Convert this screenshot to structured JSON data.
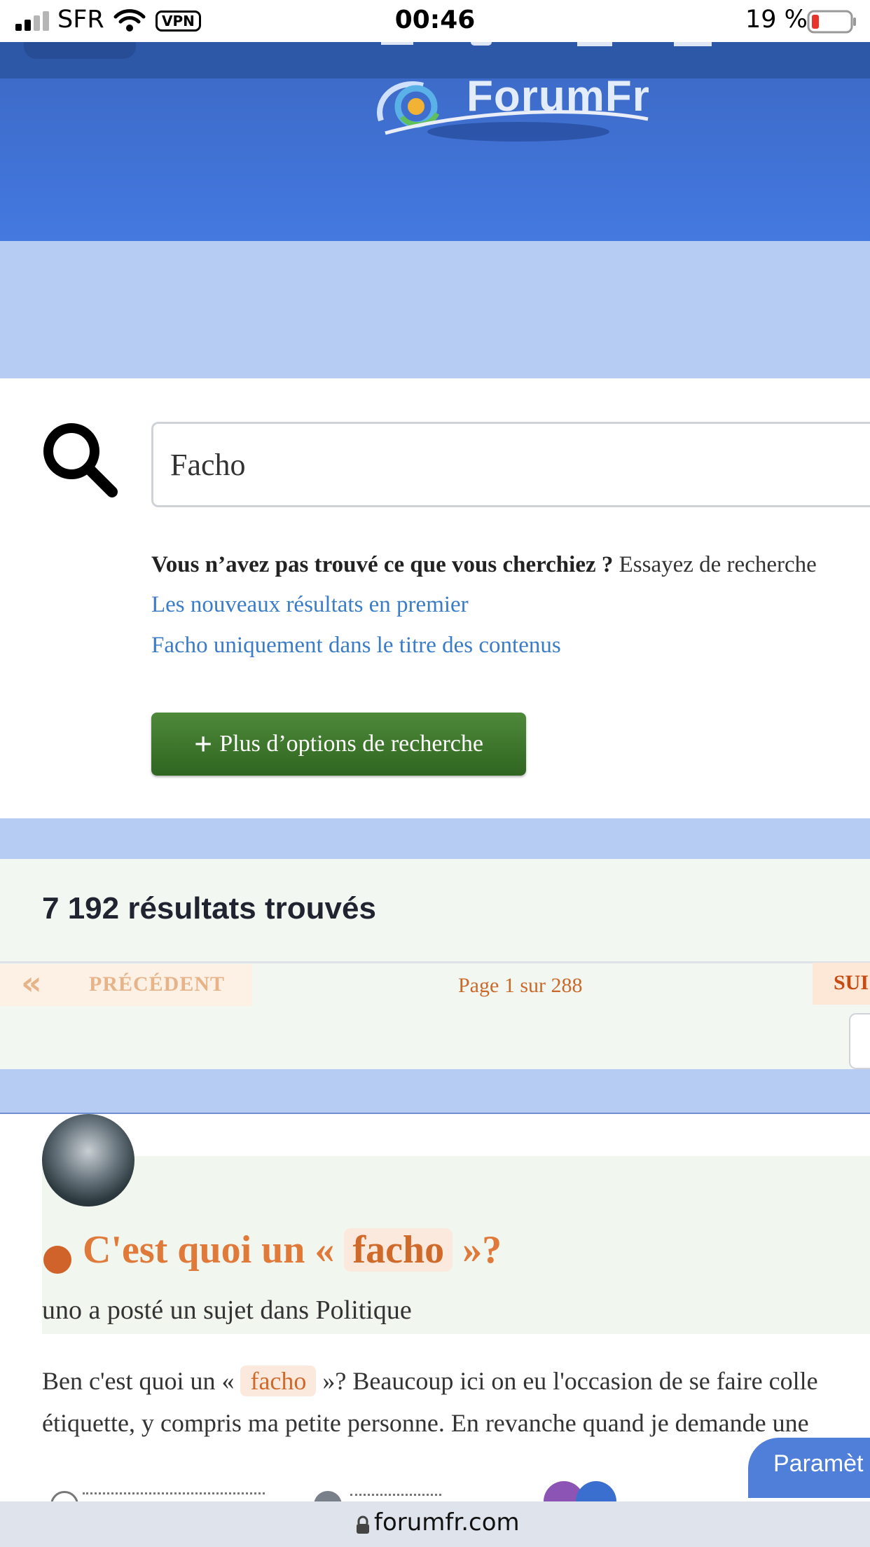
{
  "status_bar": {
    "carrier": "SFR",
    "vpn": "VPN",
    "time": "00:46",
    "battery": "19 %"
  },
  "header": {
    "logo": "ForumFr"
  },
  "search": {
    "query": "Facho",
    "hint_bold": "Vous n’avez pas trouvé ce que vous cherchiez ?",
    "hint_rest": " Essayez de recherche",
    "link_newest": "Les nouveaux résultats en premier",
    "link_title_only": "Facho uniquement dans le titre des contenus",
    "more_options_label": "Plus d’options de recherche"
  },
  "results": {
    "count_label": "7 192 résultats trouvés",
    "prev_label": "PRÉCÉDENT",
    "page_info": "Page 1 sur 288",
    "next_label": "SUI"
  },
  "result_item": {
    "title_pre": "C'est quoi un « ",
    "title_highlight": "facho",
    "title_post": " »?",
    "meta": "uno a posté un sujet dans Politique",
    "excerpt_line1_pre": "Ben c'est quoi un « ",
    "excerpt_highlight": "facho",
    "excerpt_line1_post": " »? Beaucoup ici on eu l'occasion de se faire colle",
    "excerpt_line2": "étiquette, y compris ma petite personne. En revanche quand je demande une"
  },
  "floating": {
    "params_label": "Paramèt"
  },
  "browser": {
    "url": "forumfr.com"
  },
  "colors": {
    "header_blue": "#4479e0",
    "light_band": "#b7ccf2",
    "link_blue": "#3a7cc7",
    "button_green": "#3d7a2c",
    "title_orange": "#e07a3a"
  }
}
